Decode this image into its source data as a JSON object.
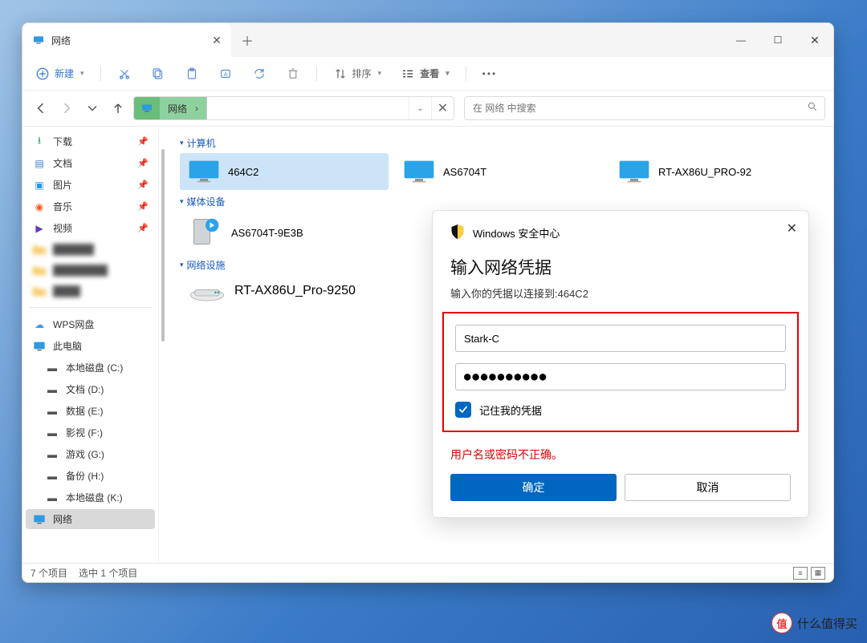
{
  "tab": {
    "title": "网络"
  },
  "toolbar": {
    "new_label": "新建",
    "sort_label": "排序",
    "view_label": "查看"
  },
  "addressbar": {
    "crumb": "网络",
    "crumb_sep": "›"
  },
  "searchbox": {
    "placeholder": "在 网络 中搜索"
  },
  "sidebar": {
    "quick": [
      {
        "key": "downloads",
        "label": "下载"
      },
      {
        "key": "documents",
        "label": "文档"
      },
      {
        "key": "pictures",
        "label": "图片"
      },
      {
        "key": "music",
        "label": "音乐"
      },
      {
        "key": "videos",
        "label": "视频"
      }
    ],
    "hidden_count": 3,
    "wps": "WPS网盘",
    "thispc": "此电脑",
    "drives": [
      "本地磁盘 (C:)",
      "文档 (D:)",
      "数据 (E:)",
      "影视 (F:)",
      "游戏 (G:)",
      "备份 (H:)",
      "本地磁盘 (K:)"
    ],
    "network": "网络"
  },
  "content": {
    "group_computers": "计算机",
    "group_media": "媒体设备",
    "group_infra": "网络设施",
    "computers": [
      "464C2",
      "AS6704T",
      "RT-AX86U_PRO-92"
    ],
    "media_device": "AS6704T-9E3B",
    "infra_device": "RT-AX86U_Pro-9250"
  },
  "dialog": {
    "security_center": "Windows 安全中心",
    "title": "输入网络凭据",
    "subtitle": "输入你的凭据以连接到:464C2",
    "username_value": "Stark-C",
    "password_mask": "●●●●●●●●●●",
    "remember_label": "记住我的凭据",
    "error": "用户名或密码不正确。",
    "ok": "确定",
    "cancel": "取消"
  },
  "status": {
    "items": "7 个项目",
    "selected": "选中 1 个项目"
  },
  "watermark": {
    "text": "什么值得买",
    "badge": "值"
  }
}
